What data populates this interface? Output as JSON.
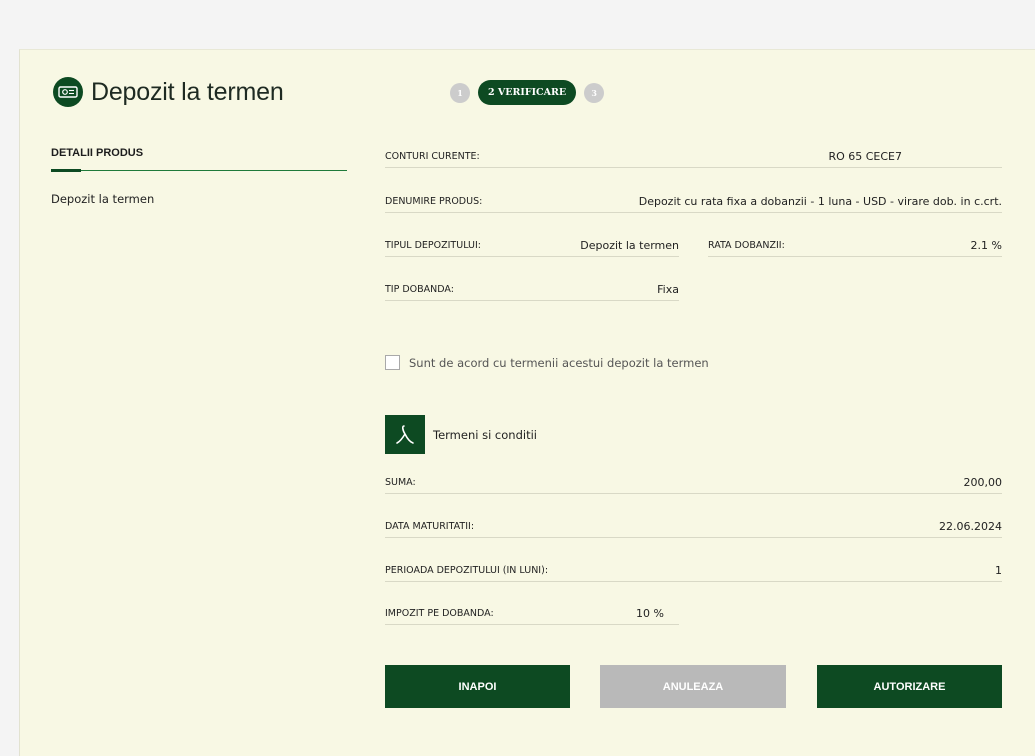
{
  "header": {
    "title": "Depozit la termen",
    "steps": [
      {
        "label": "1",
        "state": "done"
      },
      {
        "label": "2 VERIFICARE",
        "state": "active"
      },
      {
        "label": "3",
        "state": "pending"
      }
    ]
  },
  "sidebar": {
    "heading": "DETALII PRODUS",
    "items": [
      {
        "label": "Depozit la termen"
      }
    ]
  },
  "details": {
    "conturi_curente": {
      "label": "CONTURI CURENTE:",
      "value": "RO 65 CECE7"
    },
    "denumire_produs": {
      "label": "DENUMIRE PRODUS:",
      "value": "Depozit cu rata fixa a dobanzii - 1 luna - USD - virare dob. in c.crt."
    },
    "tipul_depozitului": {
      "label": "TIPUL DEPOZITULUI:",
      "value": "Depozit la termen"
    },
    "rata_dobanzii": {
      "label": "RATA DOBANZII:",
      "value": "2.1 %"
    },
    "tip_dobanda": {
      "label": "TIP DOBANDA:",
      "value": "Fixa"
    },
    "suma": {
      "label": "SUMA:",
      "value": "200,00"
    },
    "data_maturitatii": {
      "label": "DATA MATURITATII:",
      "value": "22.06.2024"
    },
    "perioada": {
      "label": "PERIOADA DEPOZITULUI (IN LUNI):",
      "value": "1"
    },
    "impozit": {
      "label": "IMPOZIT PE DOBANDA:",
      "value": "10 %"
    }
  },
  "terms": {
    "checkbox_label": "Sunt de acord cu termenii acestui depozit la termen",
    "checked": false,
    "pdf_label": "Termeni si conditii"
  },
  "buttons": {
    "back": "INAPOI",
    "cancel": "ANULEAZA",
    "authorize": "AUTORIZARE"
  },
  "colors": {
    "brand": "#0d4a22",
    "panel_bg": "#f8f8e4",
    "disabled": "#b9b9b9"
  }
}
